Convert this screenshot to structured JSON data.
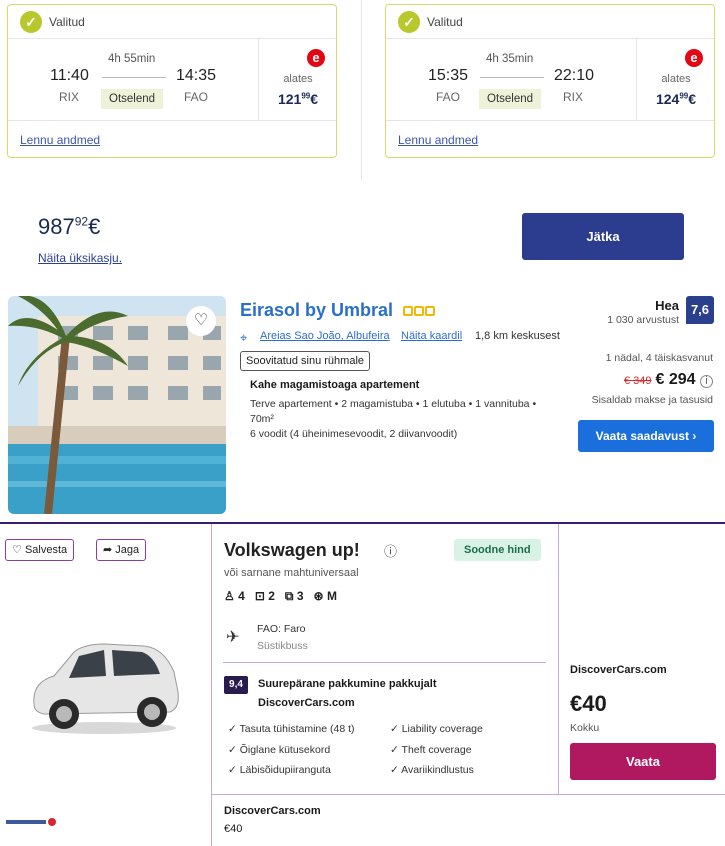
{
  "flights": [
    {
      "status": "Valitud",
      "depart_time": "11:40",
      "depart_airport": "RIX",
      "duration": "4h 55min",
      "stops": "Otselend",
      "arrive_time": "14:35",
      "arrive_airport": "FAO",
      "price_label": "alates",
      "price_main": "121",
      "price_cents": "99",
      "currency": "€",
      "details_link": "Lennu andmed"
    },
    {
      "status": "Valitud",
      "depart_time": "15:35",
      "depart_airport": "FAO",
      "duration": "4h 35min",
      "stops": "Otselend",
      "arrive_time": "22:10",
      "arrive_airport": "RIX",
      "price_label": "alates",
      "price_main": "124",
      "price_cents": "99",
      "currency": "€",
      "details_link": "Lennu andmed"
    }
  ],
  "summary": {
    "total_main": "987",
    "total_cents": "92",
    "currency": "€",
    "breakdown_link": "Näita üksikasju.",
    "continue_button": "Jätka"
  },
  "hotel": {
    "name": "Eirasol by Umbral",
    "location": "Areias Sao João, Albufeira",
    "map_link": "Näita kaardil",
    "distance": "1,8 km keskusest",
    "tag": "Soovitatud sinu rühmale",
    "room_title": "Kahe magamistoaga apartement",
    "room_desc": "Terve apartement • 2 magamistuba • 1 elutuba • 1 vannituba • 70m²",
    "beds": "6 voodit (4 üheinimesevoodit, 2 diivanvoodit)",
    "rating_word": "Hea",
    "reviews": "1 030 arvustust",
    "score": "7,6",
    "stay": "1 nädal, 4 täiskasvanut",
    "old_price": "€ 349",
    "price": "€ 294",
    "taxes": "Sisaldab makse ja tasusid",
    "cta": "Vaata saadavust"
  },
  "car": {
    "save_label": "Salvesta",
    "share_label": "Jaga",
    "title": "Volkswagen up!",
    "badge": "Soodne hind",
    "similar": "või sarnane mahtuniversaal",
    "seats": "4",
    "bags": "2",
    "doors": "3",
    "transmission": "M",
    "pickup": "FAO: Faro",
    "shuttle": "Süstikbuss",
    "score": "9,4",
    "package_label": "Suurepärane pakkumine pakkujalt",
    "supplier": "DiscoverCars.com",
    "features_left": [
      "Tasuta tühistamine (48 t)",
      "Õiglane kütusekord",
      "Läbisõidupiiranguta"
    ],
    "features_right": [
      "Liability coverage",
      "Theft coverage",
      "Avariikindlustus"
    ],
    "price_provider": "DiscoverCars.com",
    "price": "€40",
    "price_label": "Kokku",
    "cta": "Vaata"
  },
  "bottom": {
    "provider": "DiscoverCars.com",
    "price": "€40"
  }
}
